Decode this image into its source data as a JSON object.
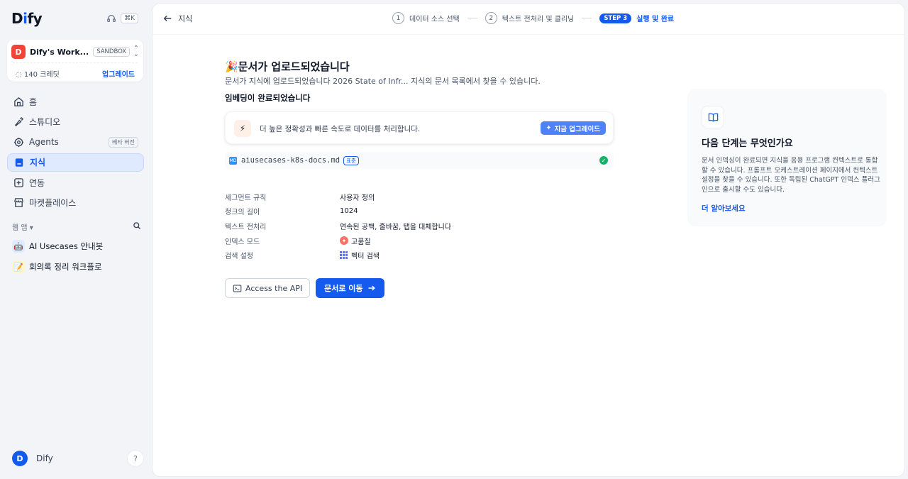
{
  "app": {
    "logo_prefix": "D",
    "logo_i": "i",
    "logo_suffix": "fy",
    "shortcut": "⌘K"
  },
  "workspace": {
    "avatar": "D",
    "name": "Dify's Work...",
    "plan": "SANDBOX",
    "credits": "140 크레딧",
    "upgrade": "업그레이드"
  },
  "nav": {
    "home": "홈",
    "studio": "스튜디오",
    "agents": "Agents",
    "agents_badge": "베타 버전",
    "knowledge": "지식",
    "integration": "연동",
    "marketplace": "마켓플레이스"
  },
  "webapps": {
    "header": "웹 앱",
    "items": [
      {
        "emoji": "🤖",
        "name": "AI Usecases 안내봇"
      },
      {
        "emoji": "📝",
        "name": "회의록 정리 워크플로"
      }
    ]
  },
  "user": {
    "avatar": "D",
    "name": "Dify",
    "help": "?"
  },
  "topbar": {
    "back_label": "지식",
    "step1_num": "1",
    "step1_label": "데이터 소스 선택",
    "step2_num": "2",
    "step2_label": "텍스트 전처리 및 클리닝",
    "step3_badge": "STEP 3",
    "step3_label": "실행 및 완료"
  },
  "result": {
    "title": "🎉문서가 업로드되었습니다",
    "subtitle": "문서가 지식에 업로드되었습니다 2026 State of Infr... 지식의 문서 목록에서 찾을 수 있습니다.",
    "embedding_title": "임베딩이 완료되었습니다",
    "upgrade_text": "더 높은 정확성과 빠른 속도로 데이터를 처리합니다.",
    "upgrade_button": "지금 업그레이드",
    "file_name": "aiusecases-k8s-docs.md",
    "file_badge": "표준",
    "file_type": "MD"
  },
  "settings": [
    {
      "key": "세그먼트 규칙",
      "value": "사용자 정의",
      "icon": ""
    },
    {
      "key": "청크의 길이",
      "value": "1024",
      "icon": ""
    },
    {
      "key": "텍스트 전처리",
      "value": "연속된 공백, 줄바꿈, 탭을 대체합니다",
      "icon": ""
    },
    {
      "key": "인덱스 모드",
      "value": "고품질",
      "icon": "quality-icon"
    },
    {
      "key": "검색 설정",
      "value": "벡터 검색",
      "icon": "vector-icon"
    }
  ],
  "actions": {
    "api": "Access the API",
    "go_doc": "문서로 이동"
  },
  "next_steps": {
    "title": "다음 단계는 무엇인가요",
    "body": "문서 인덱싱이 완료되면 지식을 응용 프로그램 컨텍스트로 통합할 수 있습니다. 프롬프트 오케스트레이션 페이지에서 컨텍스트 설정을 찾을 수 있습니다. 또한 독립된 ChatGPT 인덱스 플러그인으로 출시할 수도 있습니다.",
    "link": "더 알아보세요"
  },
  "colors": {
    "accent": "#155aef",
    "success": "#17b26a",
    "workspace_avatar": "#f04438"
  }
}
